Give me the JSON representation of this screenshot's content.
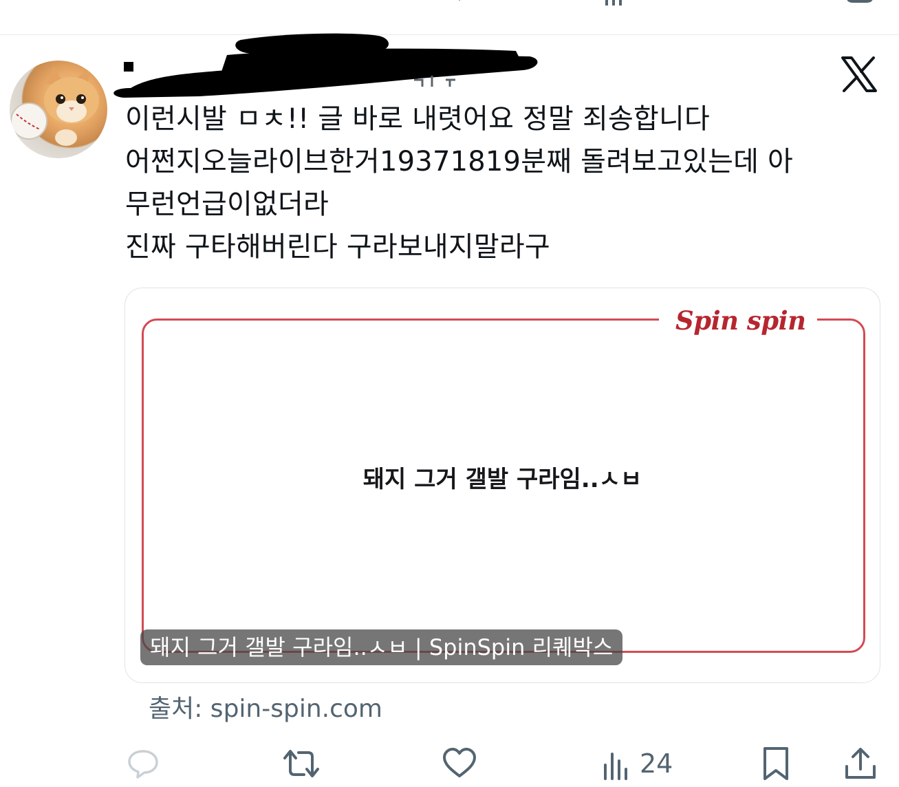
{
  "tweet": {
    "lines": [
      "이런시발 ㅁㅊ!! 글 바로 내렷어요 정말 죄송합니다",
      "어쩐지오늘라이브한거19371819분째 돌려보고있는데 아",
      "무런언급이없더라",
      "진짜 구타해버린다 구라보내지말라구"
    ]
  },
  "card": {
    "logo_text": "Spin spin",
    "message": "돼지 그거 갤발 구라임..ㅅㅂ",
    "title_overlay": "돼지 그거 갤발 구라임..ㅅㅂ | SpinSpin 리퀘박스",
    "frame_color": "#d24a53",
    "logo_color": "#b6262f"
  },
  "source": {
    "text": "출처: spin-spin.com"
  },
  "actions": {
    "reply_icon": "reply-icon",
    "retweet_icon": "retweet-icon",
    "like_icon": "heart-icon",
    "views_icon": "views-icon",
    "views_count": "24",
    "bookmark_icon": "bookmark-icon",
    "share_icon": "share-icon",
    "icon_color": "#536471"
  },
  "platform": {
    "icon": "x-logo-icon"
  }
}
